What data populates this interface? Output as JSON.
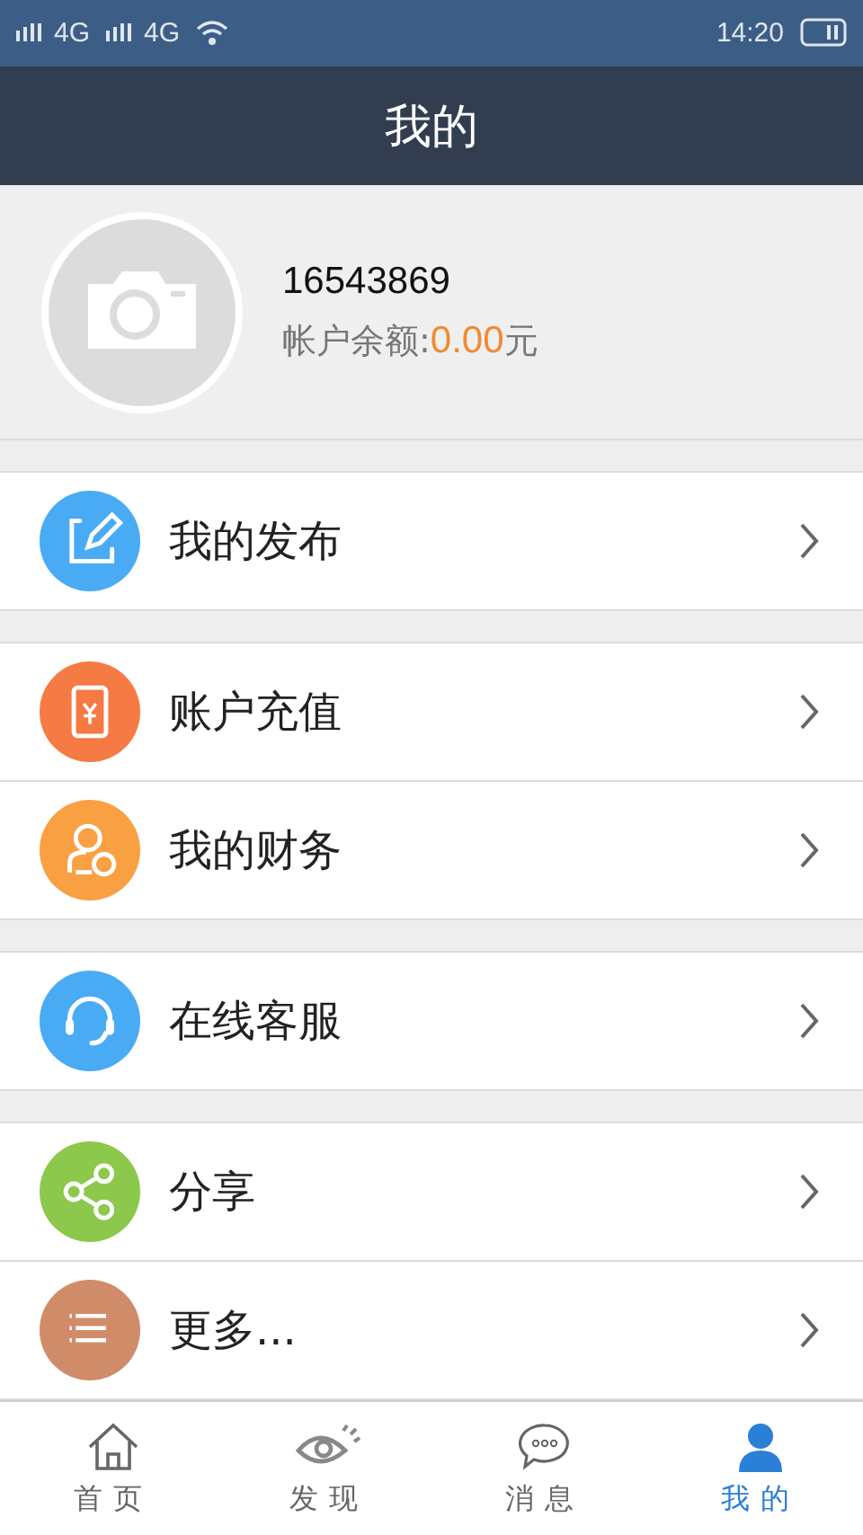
{
  "status_bar": {
    "networks": [
      "4G",
      "4G"
    ],
    "time": "14:20"
  },
  "header": {
    "title": "我的"
  },
  "profile": {
    "account": "16543869",
    "balance_label": "帐户余额:",
    "balance": "0.00",
    "currency": "元"
  },
  "menu_groups": [
    {
      "items": [
        {
          "kind": "edit",
          "label": "我的发布",
          "color": "#4aabf5"
        }
      ]
    },
    {
      "items": [
        {
          "kind": "recharge",
          "label": "账户充值",
          "color": "#f67a43"
        },
        {
          "kind": "finance",
          "label": "我的财务",
          "color": "#f9a043"
        }
      ]
    },
    {
      "items": [
        {
          "kind": "service",
          "label": "在线客服",
          "color": "#4aabf5"
        }
      ]
    },
    {
      "items": [
        {
          "kind": "share",
          "label": "分享",
          "color": "#8cc84b"
        },
        {
          "kind": "more",
          "label": "更多...",
          "color": "#d08c68"
        }
      ]
    }
  ],
  "tabs": [
    {
      "kind": "home",
      "label": "首页",
      "selected": false
    },
    {
      "kind": "discover",
      "label": "发现",
      "selected": false
    },
    {
      "kind": "message",
      "label": "消息",
      "selected": false
    },
    {
      "kind": "me",
      "label": "我的",
      "selected": true
    }
  ]
}
